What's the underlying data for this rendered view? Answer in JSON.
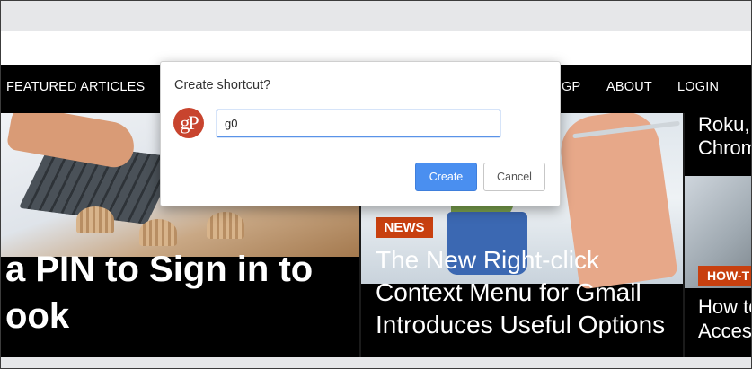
{
  "navbar": {
    "items": [
      "FEATURED ARTICLES",
      "GP",
      "ABOUT",
      "LOGIN"
    ]
  },
  "articles": {
    "left": {
      "title_line1": "a PIN to Sign in to",
      "title_line2": "ook"
    },
    "middle": {
      "badge": "NEWS",
      "title": "The New Right-click Context Menu for Gmail Introduces Useful Options"
    },
    "right_top": {
      "title_line1": "Roku,",
      "title_line2": "Chrom"
    },
    "right_bottom": {
      "badge": "HOW-T",
      "title_line1": "How to",
      "title_line2": "Acces"
    }
  },
  "dialog": {
    "title": "Create shortcut?",
    "icon_text": "gP",
    "input_value": "g0",
    "create_label": "Create",
    "cancel_label": "Cancel"
  },
  "colors": {
    "accent_blue": "#4a8ff0",
    "badge_orange": "#c8400f",
    "site_icon": "#c8442e"
  }
}
